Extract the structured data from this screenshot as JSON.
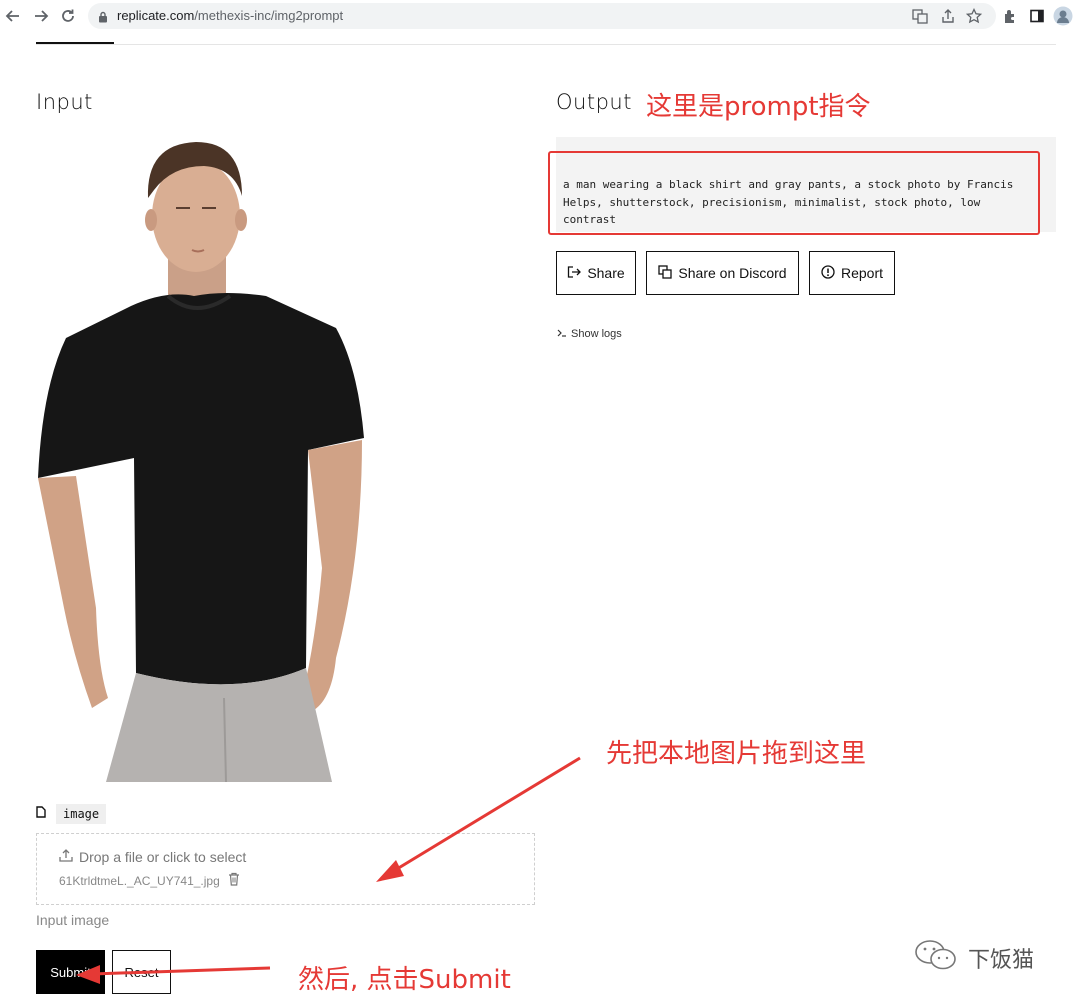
{
  "browser": {
    "url_host": "replicate.com",
    "url_path": "/methexis-inc/img2prompt"
  },
  "input": {
    "title": "Input",
    "param_name": "image",
    "drop_text": "Drop a file or click to select",
    "file_name": "61KtrldtmeL._AC_UY741_.jpg",
    "help_text": "Input image",
    "submit_label": "Submit",
    "reset_label": "Reset"
  },
  "output": {
    "title": "Output",
    "text": "a man wearing a black shirt and gray pants, a stock photo by Francis Helps, shutterstock, precisionism, minimalist, stock photo, low contrast",
    "share_label": "Share",
    "discord_label": "Share on Discord",
    "report_label": "Report",
    "show_logs_label": "Show logs"
  },
  "annotations": {
    "prompt_note": "这里是prompt指令",
    "drag_note": "先把本地图片拖到这里",
    "submit_note": "然后, 点击Submit",
    "color": "#e53935"
  },
  "watermark": {
    "text": "下饭猫"
  }
}
